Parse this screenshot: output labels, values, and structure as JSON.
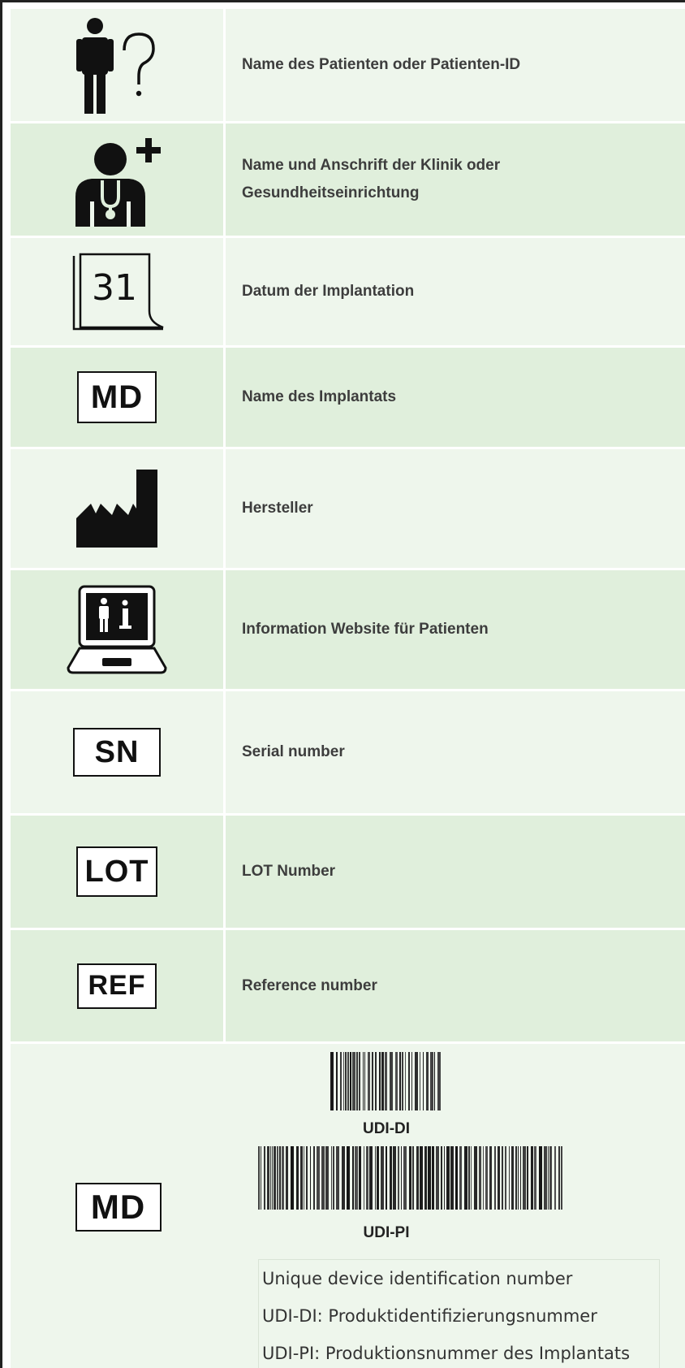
{
  "rows": [
    {
      "icon": "patient-question-icon",
      "label": "Name des Patienten oder Patienten-ID"
    },
    {
      "icon": "doctor-clinic-icon",
      "label": "Name und Anschrift der Klinik oder Gesundheitseinrichtung"
    },
    {
      "icon": "calendar-date-icon",
      "icon_text": "31",
      "label": "Datum der Implantation"
    },
    {
      "icon": "medical-device-symbol-icon",
      "icon_text": "MD",
      "label": "Name des Implantats"
    },
    {
      "icon": "manufacturer-factory-icon",
      "label": "Hersteller"
    },
    {
      "icon": "patient-information-website-icon",
      "label": "Information Website für Patienten"
    },
    {
      "icon": "serial-number-symbol-icon",
      "icon_text": "SN",
      "label": "Serial number"
    },
    {
      "icon": "lot-number-symbol-icon",
      "icon_text": "LOT",
      "label": "LOT Number"
    },
    {
      "icon": "reference-number-symbol-icon",
      "icon_text": "REF",
      "label": "Reference number"
    }
  ],
  "udi": {
    "icon": "medical-device-symbol-icon",
    "icon_text": "MD",
    "di_caption": "UDI-DI",
    "pi_caption": "UDI-PI",
    "lines": [
      "Unique device identification number",
      "UDI-DI: Produktidentifizierungsnummer",
      "UDI-PI: Produktionsnummer des Implantats"
    ]
  }
}
